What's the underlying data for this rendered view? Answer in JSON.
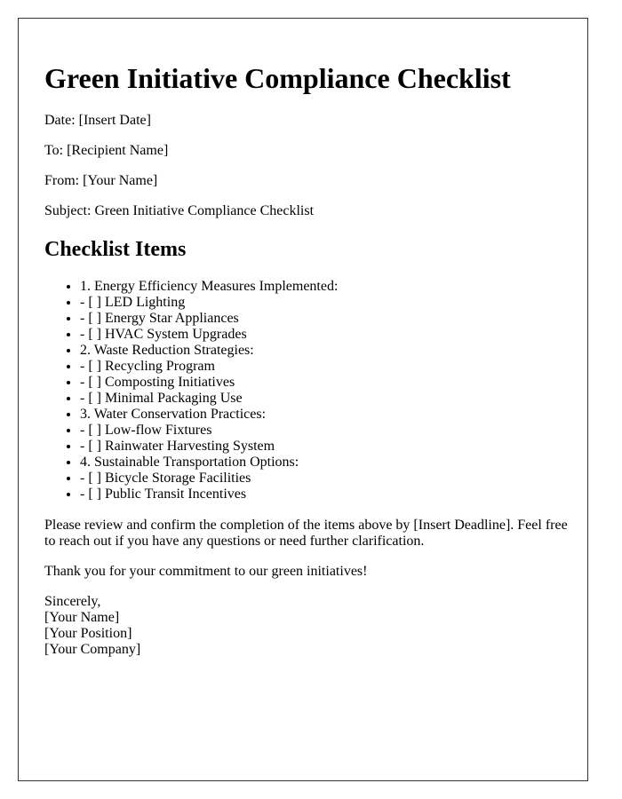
{
  "document": {
    "title": "Green Initiative Compliance Checklist",
    "meta": {
      "date": "Date: [Insert Date]",
      "to": "To: [Recipient Name]",
      "from": "From: [Your Name]",
      "subject": "Subject: Green Initiative Compliance Checklist"
    },
    "section_heading": "Checklist Items",
    "checklist": [
      "1. Energy Efficiency Measures Implemented:",
      "- [ ] LED Lighting",
      "- [ ] Energy Star Appliances",
      "- [ ] HVAC System Upgrades",
      "2. Waste Reduction Strategies:",
      "- [ ] Recycling Program",
      "- [ ] Composting Initiatives",
      "- [ ] Minimal Packaging Use",
      "3. Water Conservation Practices:",
      "- [ ] Low-flow Fixtures",
      "- [ ] Rainwater Harvesting System",
      "4. Sustainable Transportation Options:",
      "- [ ] Bicycle Storage Facilities",
      "- [ ] Public Transit Incentives"
    ],
    "closing_paragraph": "Please review and confirm the completion of the items above by [Insert Deadline]. Feel free to reach out if you have any questions or need further clarification.",
    "thanks": "Thank you for your commitment to our green initiatives!",
    "signature": {
      "salutation": "Sincerely,",
      "name": "[Your Name]",
      "position": "[Your Position]",
      "company": "[Your Company]"
    }
  }
}
